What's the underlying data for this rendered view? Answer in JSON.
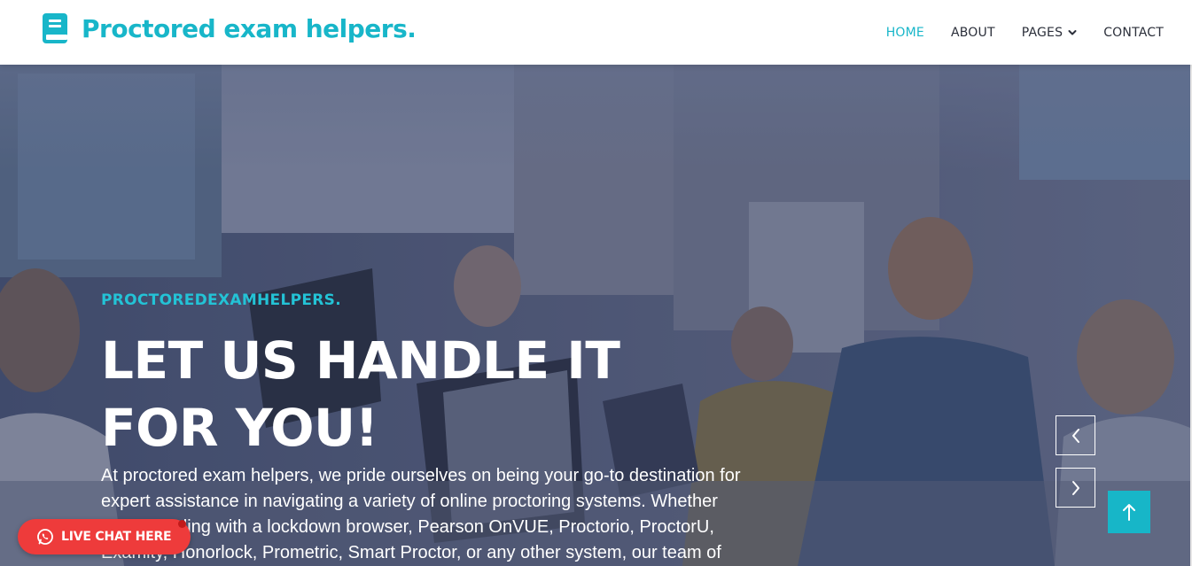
{
  "brand": {
    "name": "Proctored exam helpers.",
    "icon": "book-icon",
    "color": "#18b6c9"
  },
  "nav": {
    "items": [
      {
        "label": "HOME",
        "active": true
      },
      {
        "label": "ABOUT",
        "active": false
      },
      {
        "label": "PAGES",
        "active": false,
        "has_dropdown": true
      },
      {
        "label": "CONTACT",
        "active": false
      }
    ]
  },
  "hero": {
    "kicker": "PROCTOREDEXAMHELPERS.",
    "title": "LET US HANDLE IT FOR YOU!",
    "text": "At proctored exam helpers, we pride ourselves on being your go-to destination for expert assistance in navigating a variety of online proctoring systems. Whether you're dealing with a lockdown browser, Pearson OnVUE, Proctorio, ProctorU, Examity, Honorlock, Prometric, Smart Proctor, or any other system, our team of"
  },
  "carousel": {
    "prev_icon": "chevron-left-icon",
    "next_icon": "chevron-right-icon"
  },
  "back_to_top": {
    "icon": "arrow-up-icon",
    "color": "#17b6c8"
  },
  "live_chat": {
    "label": "LIVE CHAT HERE",
    "icon": "whatsapp-icon",
    "color": "#ee3b3b"
  }
}
